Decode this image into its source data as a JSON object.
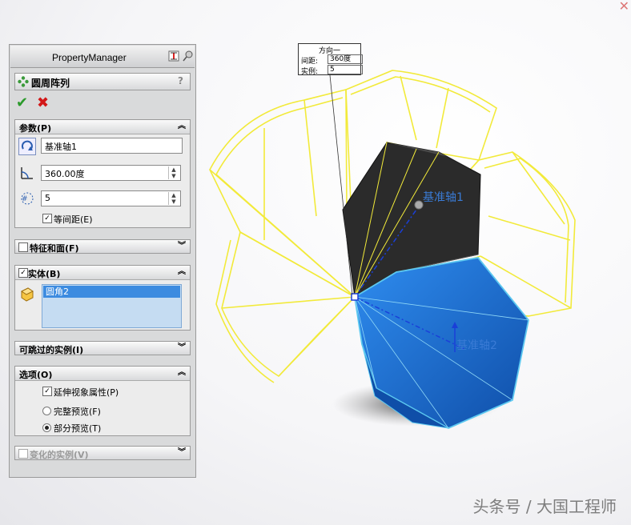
{
  "property_manager": {
    "title": "PropertyManager",
    "feature_name": "圆周阵列",
    "help": "?",
    "ok": "✔",
    "cancel": "✖",
    "params": {
      "header": "参数(P)",
      "axis": "基准轴1",
      "angle": "360.00度",
      "count": "5",
      "equal_spacing": "等间距(E)"
    },
    "features_faces": {
      "header": "特征和面(F)"
    },
    "bodies": {
      "header": "实体(B)",
      "selected": "圆角2"
    },
    "skip_instances": {
      "header": "可跳过的实例(I)"
    },
    "options": {
      "header": "选项(O)",
      "propagate": "延伸视象属性(P)",
      "full_preview": "完整预览(F)",
      "partial_preview": "部分预览(T)"
    },
    "vary_instances": {
      "header": "变化的实例(V)"
    }
  },
  "callout": {
    "title": "方向一",
    "spacing_label": "间距:",
    "spacing_value": "360度",
    "instances_label": "实例:",
    "instances_value": "5"
  },
  "viewport": {
    "axis1_label": "基准轴1",
    "axis2_label": "基准轴2"
  },
  "watermark": "头条号 / 大国工程师",
  "colors": {
    "wireframe": "#f2ea3a",
    "solid_dark": "#2b2b2b",
    "solid_blue": "#1d73d6",
    "axis": "#3a7bd5"
  }
}
